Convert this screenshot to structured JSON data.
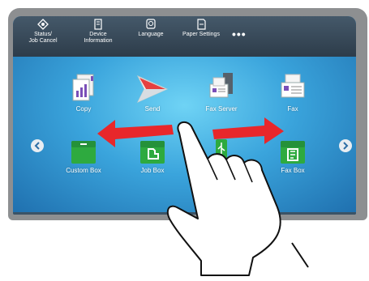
{
  "topbar": {
    "items": [
      {
        "label": "Status/\nJob Cancel",
        "icon": "status-eye-icon"
      },
      {
        "label": "Device\nInformation",
        "icon": "device-info-icon"
      },
      {
        "label": "Language",
        "icon": "language-icon"
      },
      {
        "label": "Paper Settings",
        "icon": "paper-settings-icon"
      }
    ],
    "more_label": "•••"
  },
  "apps": [
    {
      "label": "Copy",
      "icon": "copy-icon"
    },
    {
      "label": "Send",
      "icon": "send-icon"
    },
    {
      "label": "Fax Server",
      "icon": "fax-server-icon"
    },
    {
      "label": "Fax",
      "icon": "fax-icon"
    },
    {
      "label": "Custom Box",
      "icon": "custom-box-icon"
    },
    {
      "label": "Job Box",
      "icon": "job-box-icon"
    },
    {
      "label": "",
      "icon": "usb-drive-icon"
    },
    {
      "label": "Fax Box",
      "icon": "fax-box-icon"
    }
  ],
  "colors": {
    "arrow": "#e8272b",
    "box_green": "#2eaa3f",
    "topbar": "#3b4c5c"
  }
}
